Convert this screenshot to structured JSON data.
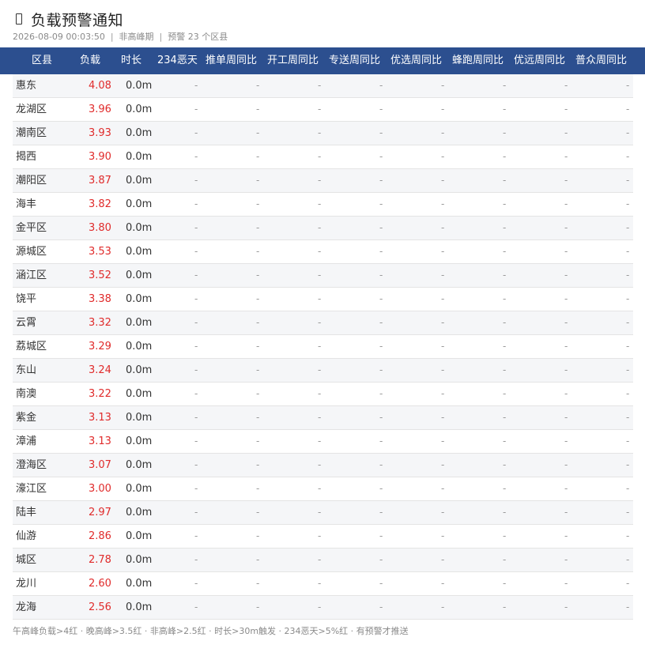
{
  "header": {
    "title": "负载预警通知",
    "datetime": "2026-08-09 00:03:50",
    "period": "非高峰期",
    "warning_count": "预警 23 个区县"
  },
  "columns": [
    "区县",
    "负载",
    "时长",
    "234恶天",
    "推单周同比",
    "开工周同比",
    "专送周同比",
    "优选周同比",
    "蜂跑周同比",
    "优远周同比",
    "普众周同比"
  ],
  "rows": [
    {
      "name": "惠东",
      "load": "4.08",
      "duration": "0.0m",
      "cells": [
        "-",
        "-",
        "-",
        "-",
        "-",
        "-",
        "-",
        "-"
      ]
    },
    {
      "name": "龙湖区",
      "load": "3.96",
      "duration": "0.0m",
      "cells": [
        "-",
        "-",
        "-",
        "-",
        "-",
        "-",
        "-",
        "-"
      ]
    },
    {
      "name": "潮南区",
      "load": "3.93",
      "duration": "0.0m",
      "cells": [
        "-",
        "-",
        "-",
        "-",
        "-",
        "-",
        "-",
        "-"
      ]
    },
    {
      "name": "揭西",
      "load": "3.90",
      "duration": "0.0m",
      "cells": [
        "-",
        "-",
        "-",
        "-",
        "-",
        "-",
        "-",
        "-"
      ]
    },
    {
      "name": "潮阳区",
      "load": "3.87",
      "duration": "0.0m",
      "cells": [
        "-",
        "-",
        "-",
        "-",
        "-",
        "-",
        "-",
        "-"
      ]
    },
    {
      "name": "海丰",
      "load": "3.82",
      "duration": "0.0m",
      "cells": [
        "-",
        "-",
        "-",
        "-",
        "-",
        "-",
        "-",
        "-"
      ]
    },
    {
      "name": "金平区",
      "load": "3.80",
      "duration": "0.0m",
      "cells": [
        "-",
        "-",
        "-",
        "-",
        "-",
        "-",
        "-",
        "-"
      ]
    },
    {
      "name": "源城区",
      "load": "3.53",
      "duration": "0.0m",
      "cells": [
        "-",
        "-",
        "-",
        "-",
        "-",
        "-",
        "-",
        "-"
      ]
    },
    {
      "name": "涵江区",
      "load": "3.52",
      "duration": "0.0m",
      "cells": [
        "-",
        "-",
        "-",
        "-",
        "-",
        "-",
        "-",
        "-"
      ]
    },
    {
      "name": "饶平",
      "load": "3.38",
      "duration": "0.0m",
      "cells": [
        "-",
        "-",
        "-",
        "-",
        "-",
        "-",
        "-",
        "-"
      ]
    },
    {
      "name": "云霄",
      "load": "3.32",
      "duration": "0.0m",
      "cells": [
        "-",
        "-",
        "-",
        "-",
        "-",
        "-",
        "-",
        "-"
      ]
    },
    {
      "name": "荔城区",
      "load": "3.29",
      "duration": "0.0m",
      "cells": [
        "-",
        "-",
        "-",
        "-",
        "-",
        "-",
        "-",
        "-"
      ]
    },
    {
      "name": "东山",
      "load": "3.24",
      "duration": "0.0m",
      "cells": [
        "-",
        "-",
        "-",
        "-",
        "-",
        "-",
        "-",
        "-"
      ]
    },
    {
      "name": "南澳",
      "load": "3.22",
      "duration": "0.0m",
      "cells": [
        "-",
        "-",
        "-",
        "-",
        "-",
        "-",
        "-",
        "-"
      ]
    },
    {
      "name": "紫金",
      "load": "3.13",
      "duration": "0.0m",
      "cells": [
        "-",
        "-",
        "-",
        "-",
        "-",
        "-",
        "-",
        "-"
      ]
    },
    {
      "name": "漳浦",
      "load": "3.13",
      "duration": "0.0m",
      "cells": [
        "-",
        "-",
        "-",
        "-",
        "-",
        "-",
        "-",
        "-"
      ]
    },
    {
      "name": "澄海区",
      "load": "3.07",
      "duration": "0.0m",
      "cells": [
        "-",
        "-",
        "-",
        "-",
        "-",
        "-",
        "-",
        "-"
      ]
    },
    {
      "name": "濠江区",
      "load": "3.00",
      "duration": "0.0m",
      "cells": [
        "-",
        "-",
        "-",
        "-",
        "-",
        "-",
        "-",
        "-"
      ]
    },
    {
      "name": "陆丰",
      "load": "2.97",
      "duration": "0.0m",
      "cells": [
        "-",
        "-",
        "-",
        "-",
        "-",
        "-",
        "-",
        "-"
      ]
    },
    {
      "name": "仙游",
      "load": "2.86",
      "duration": "0.0m",
      "cells": [
        "-",
        "-",
        "-",
        "-",
        "-",
        "-",
        "-",
        "-"
      ]
    },
    {
      "name": "城区",
      "load": "2.78",
      "duration": "0.0m",
      "cells": [
        "-",
        "-",
        "-",
        "-",
        "-",
        "-",
        "-",
        "-"
      ]
    },
    {
      "name": "龙川",
      "load": "2.60",
      "duration": "0.0m",
      "cells": [
        "-",
        "-",
        "-",
        "-",
        "-",
        "-",
        "-",
        "-"
      ]
    },
    {
      "name": "龙海",
      "load": "2.56",
      "duration": "0.0m",
      "cells": [
        "-",
        "-",
        "-",
        "-",
        "-",
        "-",
        "-",
        "-"
      ]
    }
  ],
  "footer": "午高峰负载>4红 · 晚高峰>3.5红 · 非高峰>2.5红 · 时长>30m触发 · 234恶天>5%红 · 有预警才推送",
  "colors": {
    "header_bg": "#2c4f8f",
    "load_red": "#e02b2b"
  },
  "icons": {
    "title": "document-icon"
  }
}
